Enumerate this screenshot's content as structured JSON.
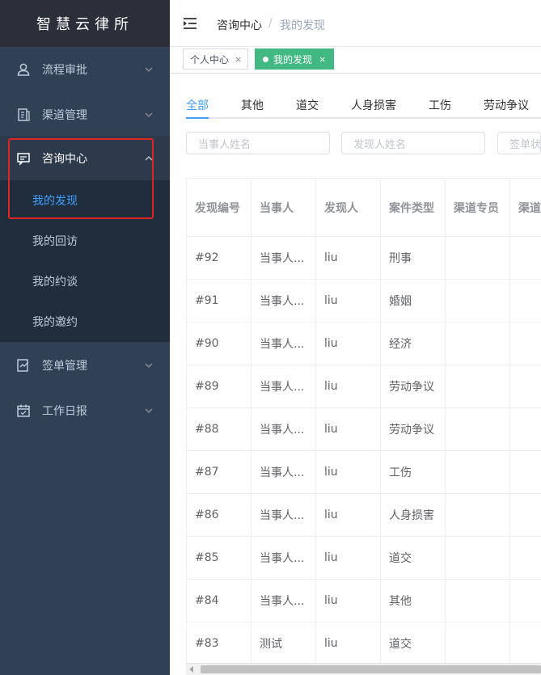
{
  "app": {
    "title": "智慧云律所"
  },
  "sidebar": {
    "items": [
      {
        "label": "流程审批",
        "icon": "user-icon"
      },
      {
        "label": "渠道管理",
        "icon": "channel-icon"
      },
      {
        "label": "咨询中心",
        "icon": "chat-icon"
      },
      {
        "label": "签单管理",
        "icon": "contract-icon"
      },
      {
        "label": "工作日报",
        "icon": "calendar-icon"
      }
    ],
    "submenu": [
      {
        "label": "我的发现"
      },
      {
        "label": "我的回访"
      },
      {
        "label": "我的约谈"
      },
      {
        "label": "我的邀约"
      }
    ]
  },
  "header": {
    "breadcrumb": [
      "咨询中心",
      "我的发现"
    ],
    "separator": "/"
  },
  "tags": [
    {
      "label": "个人中心",
      "close": "×"
    },
    {
      "label": "我的发现",
      "close": "×"
    }
  ],
  "tabs": [
    "全部",
    "其他",
    "道交",
    "人身损害",
    "工伤",
    "劳动争议"
  ],
  "filters": {
    "party_name_placeholder": "当事人姓名",
    "finder_name_placeholder": "发现人姓名",
    "sign_status_placeholder": "签单状态"
  },
  "table": {
    "columns": [
      "发现编号",
      "当事人",
      "发现人",
      "案件类型",
      "渠道专员",
      "渠道"
    ],
    "rows": [
      [
        "#92",
        "当事人...",
        "liu",
        "刑事",
        "",
        ""
      ],
      [
        "#91",
        "当事人...",
        "liu",
        "婚姻",
        "",
        ""
      ],
      [
        "#90",
        "当事人...",
        "liu",
        "经济",
        "",
        ""
      ],
      [
        "#89",
        "当事人...",
        "liu",
        "劳动争议",
        "",
        ""
      ],
      [
        "#88",
        "当事人...",
        "liu",
        "劳动争议",
        "",
        ""
      ],
      [
        "#87",
        "当事人...",
        "liu",
        "工伤",
        "",
        ""
      ],
      [
        "#86",
        "当事人...",
        "liu",
        "人身损害",
        "",
        ""
      ],
      [
        "#85",
        "当事人...",
        "liu",
        "道交",
        "",
        ""
      ],
      [
        "#84",
        "当事人...",
        "liu",
        "其他",
        "",
        ""
      ],
      [
        "#83",
        "测试",
        "liu",
        "道交",
        "",
        ""
      ]
    ]
  },
  "colors": {
    "sidebar_bg": "#304156",
    "submenu_bg": "#1f2d3d",
    "accent": "#409eff",
    "active_tag": "#42b983",
    "highlight": "#e02424"
  }
}
